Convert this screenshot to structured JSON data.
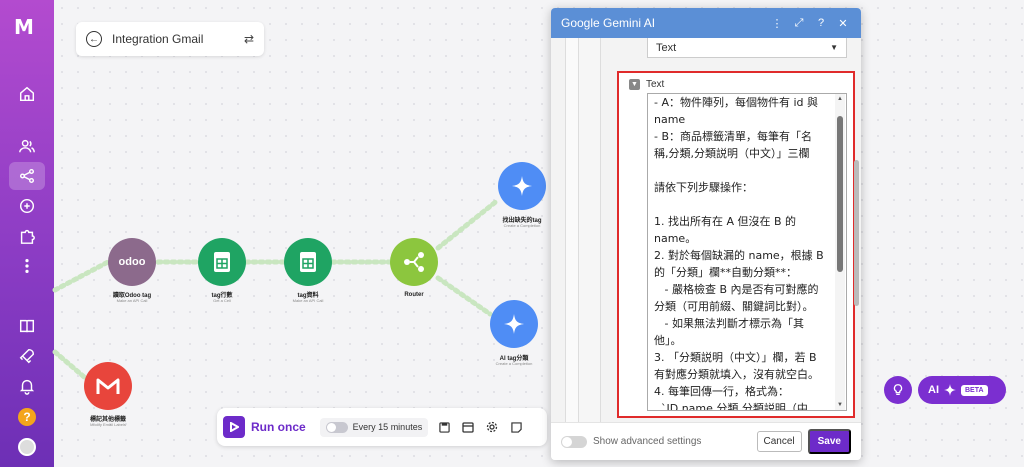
{
  "app": {
    "logo_text": "M"
  },
  "scenario": {
    "title": "Integration Gmail"
  },
  "nodes": [
    {
      "id": "odoo",
      "label": "讀取Odoo tag",
      "sub": "Make an API Call",
      "icon_text": "odoo",
      "color": "#8c6a8c"
    },
    {
      "id": "sheets1",
      "label": "tag行數",
      "sub": "Get a Cell",
      "color": "#1fa463"
    },
    {
      "id": "sheets2",
      "label": "tag資料",
      "sub": "Make an API Call",
      "color": "#1fa463"
    },
    {
      "id": "router",
      "label": "Router",
      "sub": "",
      "color": "#8cc63e"
    },
    {
      "id": "gemini1",
      "label": "找出缺失的tag",
      "sub": "Create a Completion",
      "color": "#4f8df5"
    },
    {
      "id": "gemini2",
      "label": "AI tag分類",
      "sub": "Create a Completion",
      "color": "#4f8df5"
    },
    {
      "id": "gmail",
      "label": "標記其他標籤",
      "sub": "Modify Email Labels",
      "color": "#e8453c"
    }
  ],
  "toolbar": {
    "run_label": "Run once",
    "schedule_label": "Every 15 minutes"
  },
  "modal": {
    "title": "Google Gemini AI",
    "type_select_value": "Text",
    "field_label": "Text",
    "text_lines": [
      "- A：物件陣列，每個物件有 id 與",
      "name",
      "- B：商品標籤清單，每筆有「名",
      "稱,分類,分類説明（中文）」三欄",
      "",
      "請依下列步驟操作：",
      "",
      "1. 找出所有在 A 但沒在 B 的",
      "name。",
      "2. 對於每個缺漏的 name，根據 B",
      "的「分類」欄**自動分類**：",
      "   - 嚴格檢查 B 內是否有可對應的",
      "分類（可用前綴、關鍵詞比對）。",
      "   - 如果無法判斷才標示為「其",
      "他」。",
      "3. 「分類説明（中文）」欄，若 B",
      "有對應分類就填入，沒有就空白。",
      "4. 每筆回傳一行，格式為：",
      "  `ID,name,分類,分類説明（中"
    ],
    "advanced_label": "Show advanced settings",
    "cancel_label": "Cancel",
    "save_label": "Save"
  },
  "ai": {
    "label": "AI",
    "beta": "BETA"
  },
  "colors": {
    "brand": "#6d2bc9",
    "header": "#5b8fd6",
    "highlight": "#e02b2b"
  }
}
